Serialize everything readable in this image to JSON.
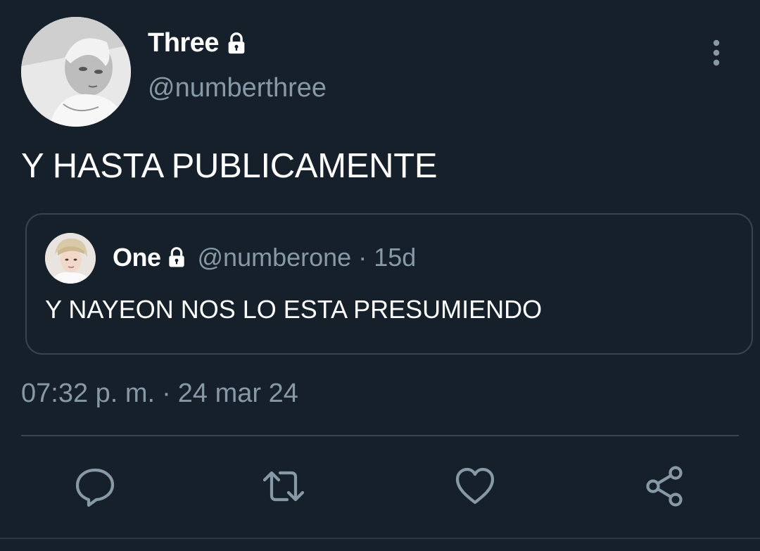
{
  "author": {
    "display_name": "Three",
    "handle": "@numberthree",
    "protected_icon": "lock-icon",
    "avatar_icon": "user-avatar-photo"
  },
  "tweet": {
    "text": "Y HASTA PUBLICAMENTE",
    "time": "07:32 p. m.",
    "separator": "·",
    "date": "24 mar 24"
  },
  "quoted_tweet": {
    "display_name": "One",
    "handle": "@numberone",
    "separator": "·",
    "age": "15d",
    "text": "Y NAYEON NOS LO ESTA PRESUMIENDO",
    "protected_icon": "lock-icon"
  },
  "actions": {
    "reply_icon": "reply-icon",
    "retweet_icon": "retweet-icon",
    "like_icon": "heart-icon",
    "share_icon": "share-icon",
    "more_icon": "more-vertical-icon"
  },
  "colors": {
    "background": "#15202b",
    "primary_text": "#ffffff",
    "secondary_text": "#8899a6",
    "border": "#38444d"
  }
}
